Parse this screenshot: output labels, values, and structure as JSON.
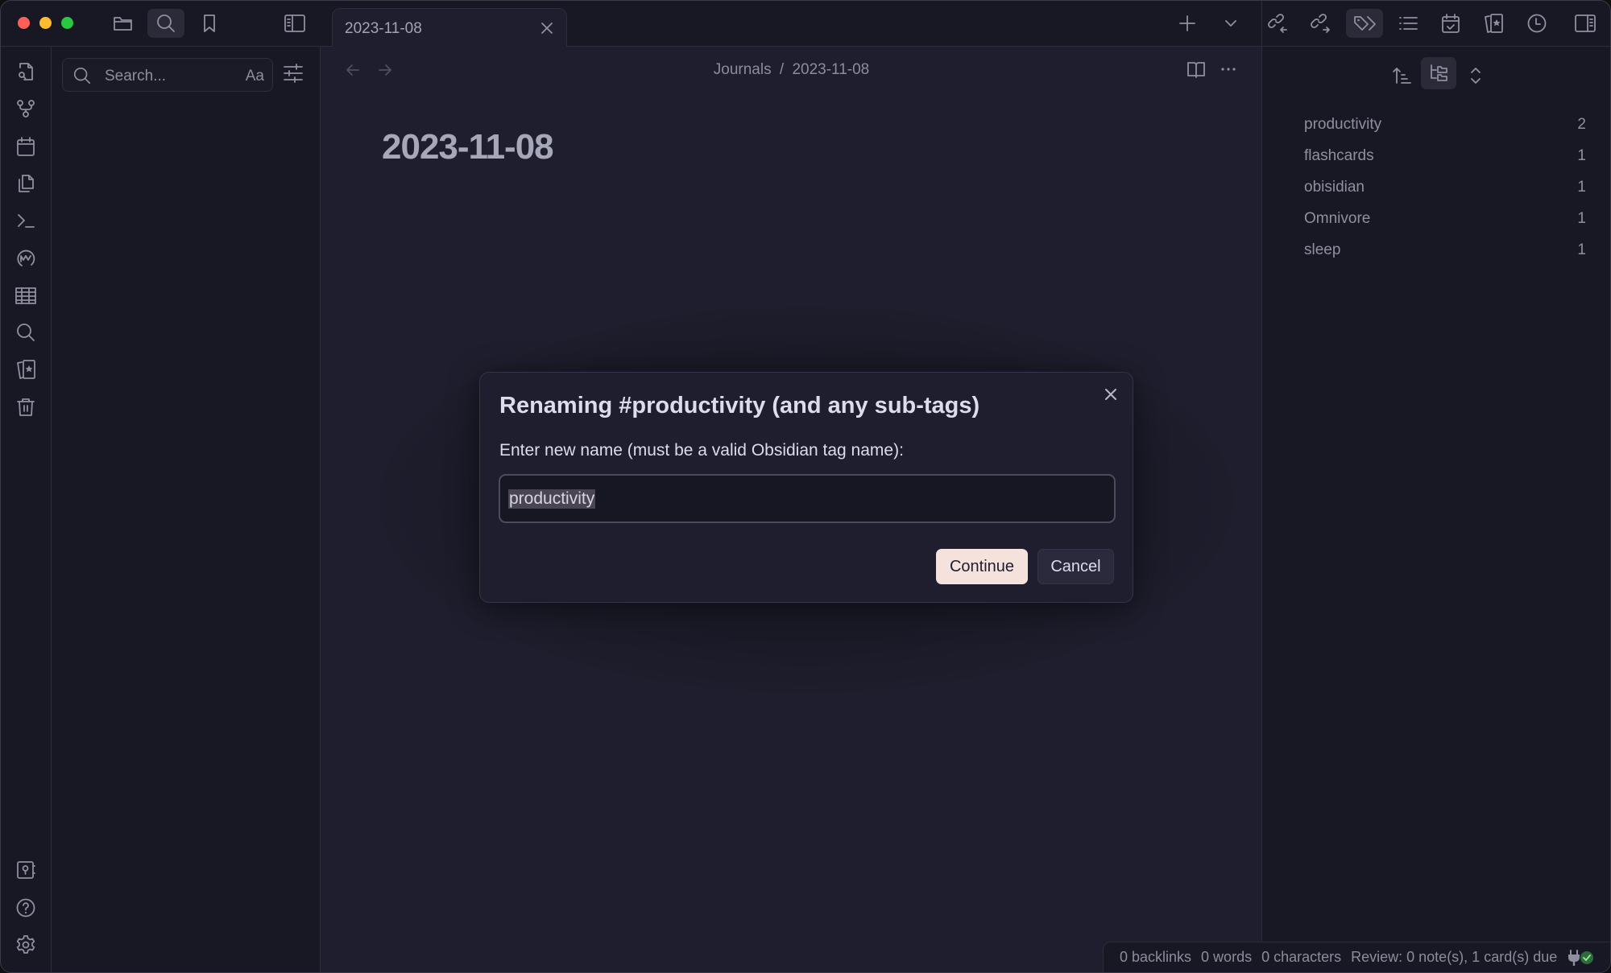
{
  "window": {
    "traffic_lights": [
      {
        "name": "close",
        "color": "#fe5f57"
      },
      {
        "name": "minimize",
        "color": "#febc2e"
      },
      {
        "name": "zoom",
        "color": "#28c840"
      }
    ]
  },
  "toolbar_left": {
    "buttons": [
      {
        "icon": "folder-icon",
        "label": "Files"
      },
      {
        "icon": "search-icon",
        "label": "Search",
        "active": true
      },
      {
        "icon": "bookmark-icon",
        "label": "Bookmarks"
      }
    ],
    "toggle_sidebar_icon": "sidebar-left-icon"
  },
  "tabs": [
    {
      "title": "2023-11-08",
      "active": true
    }
  ],
  "tab_actions": {
    "new_tab_icon": "plus-icon",
    "tab_list_icon": "chevron-down-icon"
  },
  "toolbar_right": {
    "buttons": [
      {
        "icon": "backlinks-icon"
      },
      {
        "icon": "outgoing-links-icon"
      },
      {
        "icon": "tags-icon",
        "active": true
      },
      {
        "icon": "outline-icon"
      },
      {
        "icon": "calendar-check-icon"
      },
      {
        "icon": "flashcards-icon"
      },
      {
        "icon": "clock-icon"
      },
      {
        "icon": "sidebar-right-icon"
      }
    ]
  },
  "ribbon": {
    "top": [
      {
        "icon": "file-search-icon"
      },
      {
        "icon": "graph-icon"
      },
      {
        "icon": "calendar-icon"
      },
      {
        "icon": "copy-icon"
      },
      {
        "icon": "terminal-icon"
      },
      {
        "icon": "omnivore-icon"
      },
      {
        "icon": "table-icon"
      },
      {
        "icon": "search-icon"
      },
      {
        "icon": "flashcards-icon"
      },
      {
        "icon": "trash-icon"
      }
    ],
    "bottom": [
      {
        "icon": "vault-icon"
      },
      {
        "icon": "help-icon"
      },
      {
        "icon": "settings-icon"
      }
    ]
  },
  "search": {
    "placeholder": "Search...",
    "match_case_label": "Aa"
  },
  "editor": {
    "breadcrumb": [
      "Journals",
      "/",
      "2023-11-08"
    ],
    "title": "2023-11-08"
  },
  "tags_pane": {
    "tags": [
      {
        "name": "productivity",
        "count": "2"
      },
      {
        "name": "flashcards",
        "count": "1"
      },
      {
        "name": "obisidian",
        "count": "1"
      },
      {
        "name": "Omnivore",
        "count": "1"
      },
      {
        "name": "sleep",
        "count": "1"
      }
    ]
  },
  "modal": {
    "title": "Renaming #productivity (and any sub-tags)",
    "label": "Enter new name (must be a valid Obsidian tag name):",
    "input_value": "productivity",
    "continue_label": "Continue",
    "cancel_label": "Cancel"
  },
  "status_bar": {
    "backlinks": "0 backlinks",
    "words": "0 words",
    "characters": "0 characters",
    "review": "Review: 0 note(s), 1 card(s) due"
  }
}
